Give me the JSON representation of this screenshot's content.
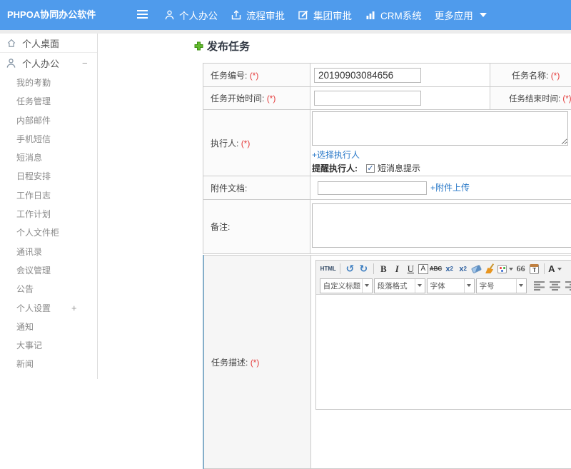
{
  "colors": {
    "topbar_background": "#4f9bec",
    "link_blue": "#2878c8",
    "required_red": "#e43b3b",
    "add_icon_green": "#62b92e",
    "desc_table_accent_border": "#85aec9"
  },
  "topbar": {
    "logo": "PHPOA协同办公软件",
    "nav": [
      {
        "icon": "user-icon",
        "label": "个人办公"
      },
      {
        "icon": "workflow-approval-icon",
        "label": "流程审批"
      },
      {
        "icon": "group-approval-icon",
        "label": "集团审批"
      },
      {
        "icon": "bar-chart-icon",
        "label": "CRM系统"
      },
      {
        "icon": "caret-down-icon",
        "label": "更多应用"
      }
    ]
  },
  "sidebar": {
    "desktop_label": "个人桌面",
    "office_group": {
      "label": "个人办公",
      "collapse_symbol": "−"
    },
    "items": [
      "我的考勤",
      "任务管理",
      "内部邮件",
      "手机短信",
      "短消息",
      "日程安排",
      "工作日志",
      "工作计划",
      "个人文件柜",
      "通讯录",
      "会议管理",
      "公告"
    ],
    "settings_group": {
      "label": "个人设置",
      "expand_symbol": "+"
    },
    "items_after": [
      "通知",
      "大事记",
      "新闻"
    ]
  },
  "main": {
    "page_title": "发布任务",
    "form": {
      "required_mark": "(*)",
      "task_number_label": "任务编号:",
      "task_number_value": "20190903084656",
      "task_name_label": "任务名称:",
      "start_time_label": "任务开始时间:",
      "end_time_label": "任务结束时间:",
      "executor_label": "执行人:",
      "choose_executor_link": "+选择执行人",
      "remind_executor_label": "提醒执行人:",
      "sms_tip_label": "短消息提示",
      "sms_tip_checked": true,
      "attachment_label": "附件文档:",
      "attachment_upload_link": "+附件上传",
      "remark_label": "备注:",
      "task_desc_label": "任务描述:"
    },
    "editor": {
      "html_button": "HTML",
      "quote_button": "66",
      "font_button": "A",
      "heading_select": "自定义标题",
      "paragraph_select": "段落格式",
      "font_select": "字体",
      "size_select": "字号"
    }
  }
}
